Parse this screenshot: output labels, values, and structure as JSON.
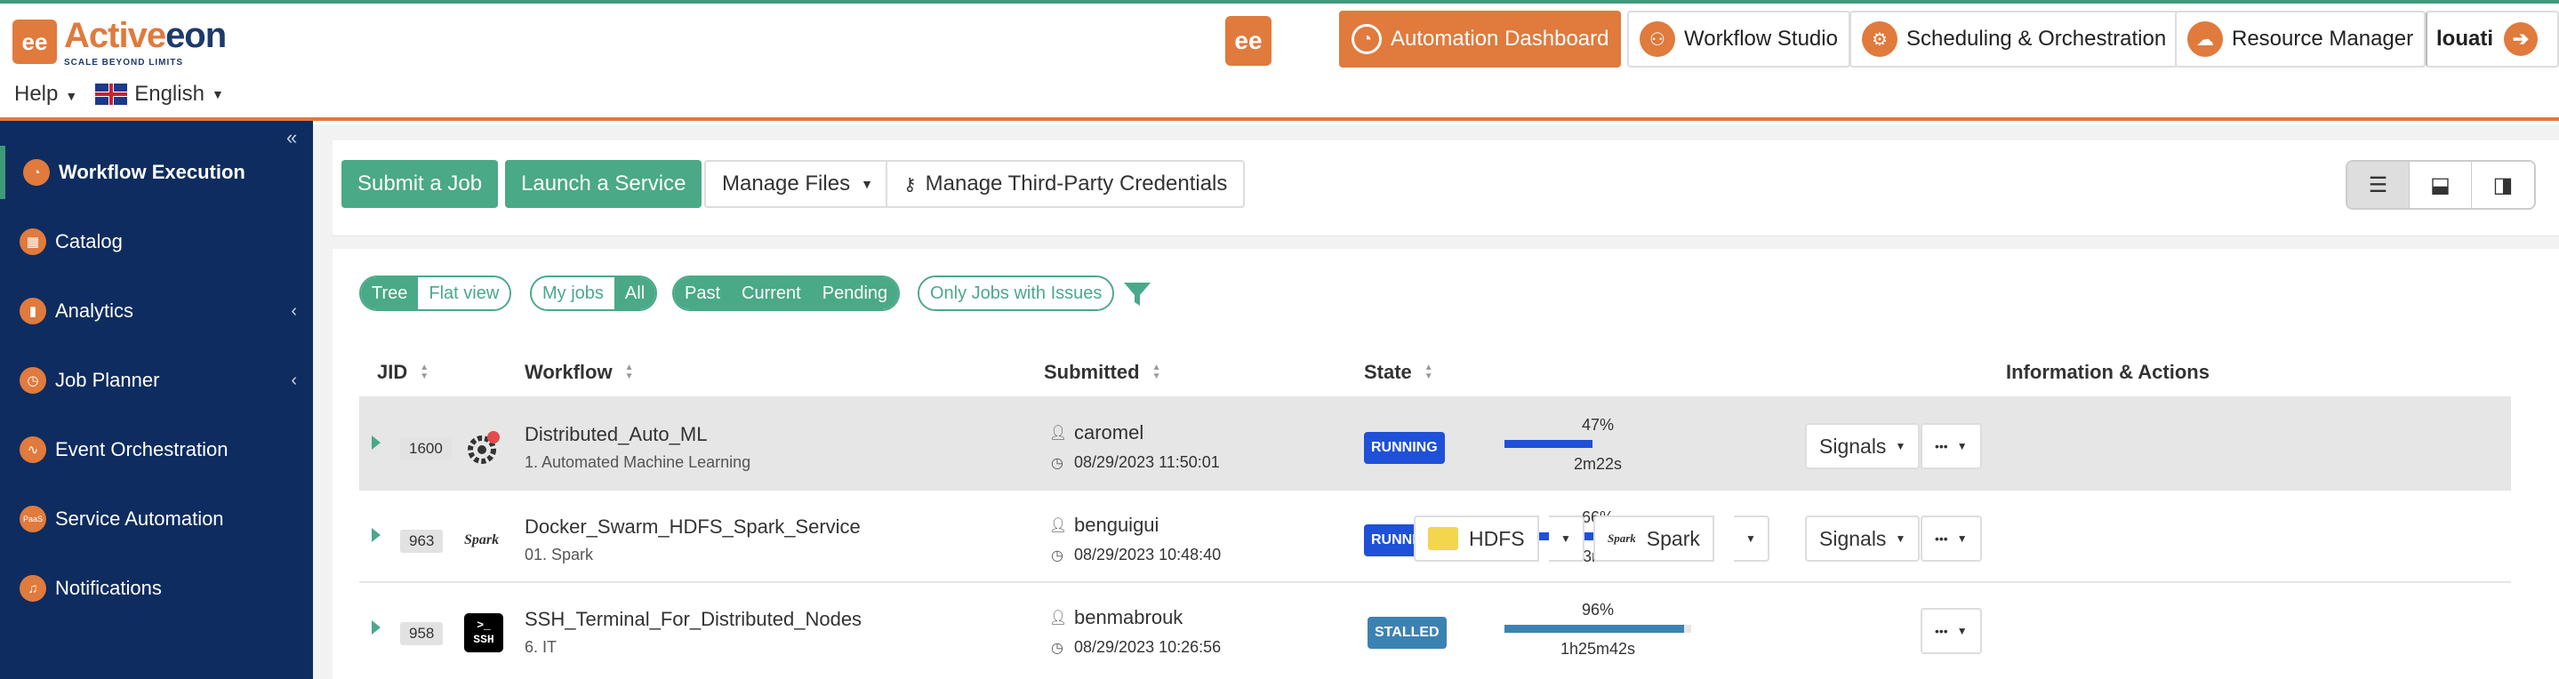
{
  "brand": {
    "logo_glyph": "ee",
    "name_part1": "Active",
    "name_part2": "eon",
    "tagline": "SCALE BEYOND LIMITS",
    "accent": "#e07a3d",
    "dark": "#1c3a6b",
    "green": "#4aa987",
    "sidebar_bg": "#0e2c5f"
  },
  "header": {
    "help_label": "Help",
    "language_label": "English",
    "center_glyph": "ee",
    "nav": [
      {
        "label": "Automation Dashboard",
        "icon": "gauge-icon",
        "active": true
      },
      {
        "label": "Workflow Studio",
        "icon": "workflow-icon",
        "active": false
      },
      {
        "label": "Scheduling & Orchestration",
        "icon": "gears-icon",
        "active": false
      },
      {
        "label": "Resource Manager",
        "icon": "cloud-icon",
        "active": false
      }
    ],
    "user": "louati"
  },
  "sidebar": {
    "items": [
      {
        "label": "Workflow Execution",
        "icon": "gauge-icon",
        "active": true,
        "has_chevron": false
      },
      {
        "label": "Catalog",
        "icon": "catalog-icon",
        "active": false,
        "has_chevron": false
      },
      {
        "label": "Analytics",
        "icon": "analytics-icon",
        "active": false,
        "has_chevron": true
      },
      {
        "label": "Job Planner",
        "icon": "clock-icon",
        "active": false,
        "has_chevron": true
      },
      {
        "label": "Event Orchestration",
        "icon": "pulse-icon",
        "active": false,
        "has_chevron": false
      },
      {
        "label": "Service Automation",
        "icon": "paas-icon",
        "active": false,
        "has_chevron": false
      },
      {
        "label": "Notifications",
        "icon": "bell-icon",
        "active": false,
        "has_chevron": false
      }
    ],
    "paas_glyph": "PaaS"
  },
  "toolbar": {
    "submit_job": "Submit a Job",
    "launch_service": "Launch a Service",
    "manage_files": "Manage Files",
    "manage_credentials": "Manage Third-Party Credentials"
  },
  "filters": {
    "tree": "Tree",
    "flat": "Flat view",
    "my_jobs": "My jobs",
    "all": "All",
    "past": "Past",
    "current": "Current",
    "pending": "Pending",
    "issues": "Only Jobs with Issues"
  },
  "table": {
    "headers": {
      "jid": "JID",
      "workflow": "Workflow",
      "submitted": "Submitted",
      "state": "State",
      "info": "Information & Actions"
    },
    "rows": [
      {
        "jid": "1600",
        "name": "Distributed_Auto_ML",
        "sub": "1. Automated Machine Learning",
        "icon": "automl-icon",
        "user": "caromel",
        "date": "08/29/2023 11:50:01",
        "state": "RUNNING",
        "progress_pct": "47%",
        "progress": 47,
        "duration": "2m22s",
        "highlighted": true
      },
      {
        "jid": "963",
        "name": "Docker_Swarm_HDFS_Spark_Service",
        "sub": "01. Spark",
        "icon": "spark-icon",
        "icon_text": "Spark",
        "user": "benguigui",
        "date": "08/29/2023 10:48:40",
        "state": "RUNNING",
        "progress_pct": "66%",
        "progress": 66,
        "duration": "1h3m58s",
        "highlighted": false,
        "endpoints": [
          "HDFS",
          "Spark"
        ],
        "endpoint_small": "Spark"
      },
      {
        "jid": "958",
        "name": "SSH_Terminal_For_Distributed_Nodes",
        "sub": "6. IT",
        "icon": "ssh-terminal-icon",
        "icon_text": "SSH",
        "user": "benmabrouk",
        "date": "08/29/2023 10:26:56",
        "state": "STALLED",
        "progress_pct": "96%",
        "progress": 96,
        "duration": "1h25m42s",
        "highlighted": false
      }
    ],
    "signals_label": "Signals",
    "more_glyph": "•••"
  }
}
